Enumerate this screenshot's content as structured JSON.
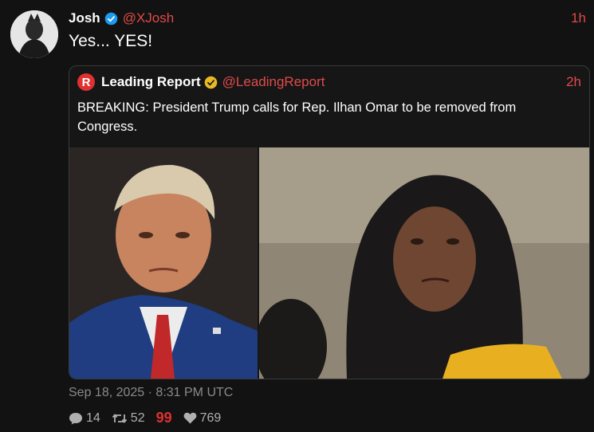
{
  "author": {
    "name": "Josh",
    "handle": "@XJosh",
    "time": "1h",
    "text": "Yes... YES!"
  },
  "quoted": {
    "logo_letter": "R",
    "name": "Leading Report",
    "handle": "@LeadingReport",
    "time": "2h",
    "text": "BREAKING: President Trump calls for Rep. Ilhan Omar to be removed from Congress."
  },
  "meta": {
    "timestamp": "Sep 18, 2025 · 8:31 PM UTC"
  },
  "stats": {
    "replies": "14",
    "retweets": "52",
    "quote_marks": "99",
    "likes": "769"
  },
  "colors": {
    "background": "#121212",
    "accent_red": "#e04a4a",
    "verified_blue": "#1d9bf0",
    "verified_gold": "#e8b923"
  }
}
